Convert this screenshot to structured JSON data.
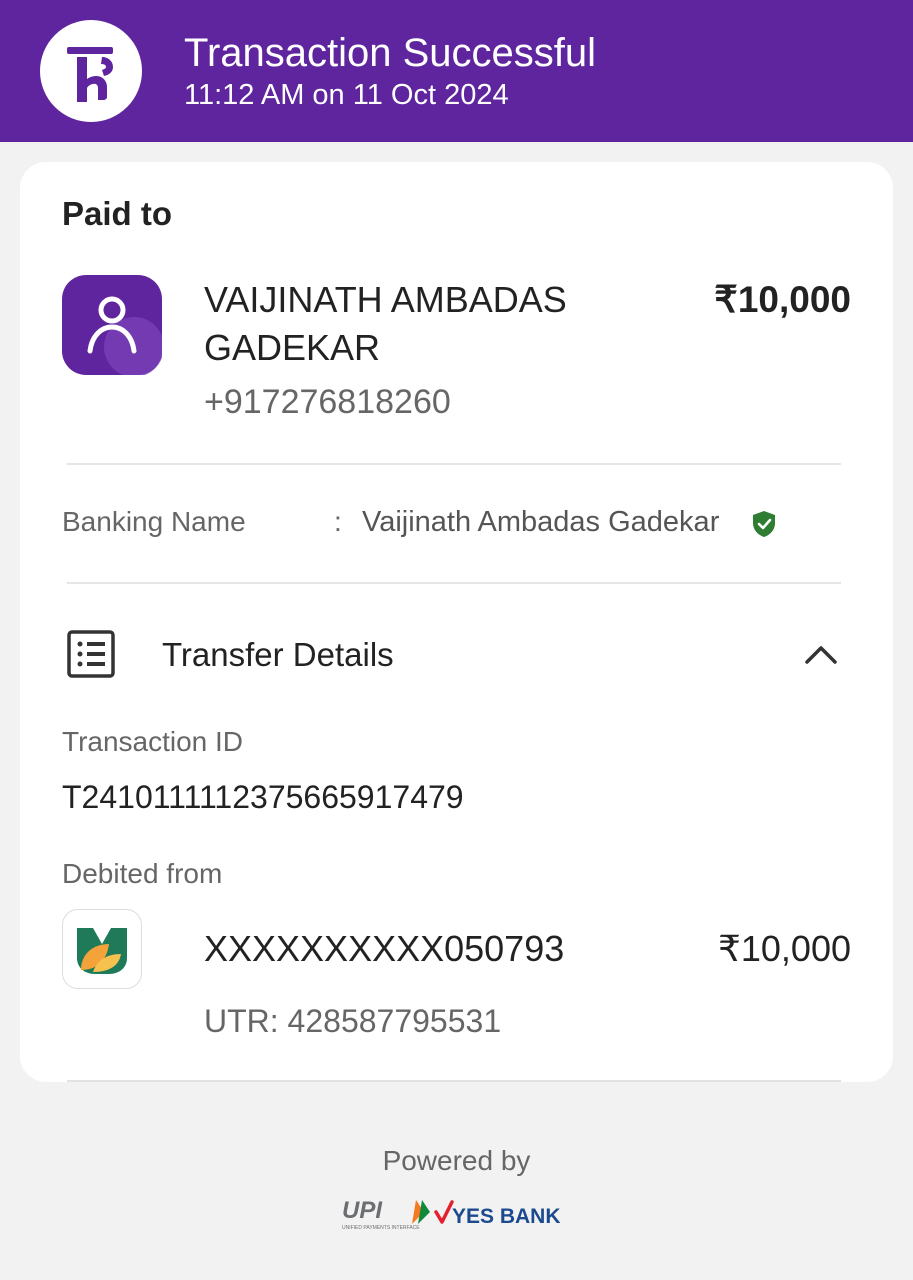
{
  "header": {
    "title": "Transaction Successful",
    "timestamp": "11:12 AM on 11 Oct 2024",
    "logo_icon": "phonepe-logo-icon",
    "brand_color": "#5f259f"
  },
  "payment": {
    "paid_to_label": "Paid to",
    "payee_name": "VAIJINATH AMBADAS GADEKAR",
    "payee_phone": "+917276818260",
    "amount": "₹10,000",
    "avatar_icon": "person-icon"
  },
  "banking": {
    "label": "Banking Name",
    "separator": ":",
    "value": "Vaijinath Ambadas Gadekar",
    "verified_icon": "verified-shield-icon",
    "verified_color": "#2e7d32"
  },
  "transfer": {
    "title": "Transfer Details",
    "list_icon": "receipt-list-icon",
    "toggle_icon": "chevron-up-icon",
    "transaction_id_label": "Transaction ID",
    "transaction_id": "T2410111112375665917479",
    "debited_from_label": "Debited from",
    "account_number": "XXXXXXXXXX050793",
    "debited_amount": "₹10,000",
    "utr": "UTR: 428587795531",
    "bank_icon": "bank-logo-icon"
  },
  "footer": {
    "powered_by": "Powered by",
    "upi_logo": "UPI",
    "upi_tagline": "UNIFIED PAYMENTS INTERFACE",
    "bank_logo": "YES BANK"
  }
}
